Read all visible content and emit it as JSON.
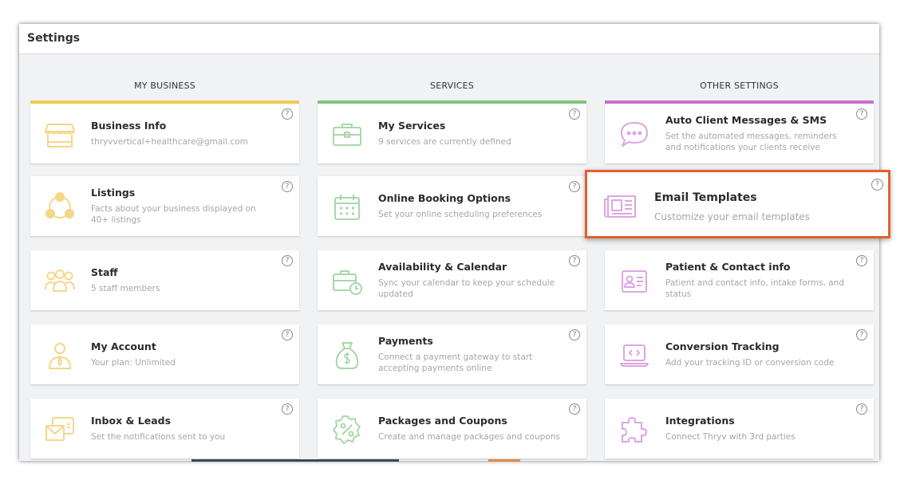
{
  "window": {
    "title": "Settings"
  },
  "columns": [
    {
      "header": "MY BUSINESS",
      "accent": "#f2c94c",
      "icon_color": "#f5d78a"
    },
    {
      "header": "SERVICES",
      "accent": "#7dc47d",
      "icon_color": "#a8d8a8"
    },
    {
      "header": "OTHER SETTINGS",
      "accent": "#c56fcf",
      "icon_color": "#dca6e2"
    }
  ],
  "help_glyph": "?",
  "cards": {
    "business_info": {
      "title": "Business Info",
      "desc": "thryvvertical+healthcare@gmail.com",
      "icon": "storefront-icon"
    },
    "listings": {
      "title": "Listings",
      "desc": "Facts about your business displayed on 40+ listings",
      "icon": "network-people-icon"
    },
    "staff": {
      "title": "Staff",
      "desc": "5 staff members",
      "icon": "group-icon"
    },
    "my_account": {
      "title": "My Account",
      "desc": "Your plan: Unlimited",
      "icon": "person-icon"
    },
    "inbox_leads": {
      "title": "Inbox & Leads",
      "desc": "Set the notifications sent to you",
      "icon": "envelope-icon"
    },
    "my_services": {
      "title": "My Services",
      "desc": "9 services are currently defined",
      "icon": "briefcase-icon"
    },
    "online_booking": {
      "title": "Online Booking Options",
      "desc": "Set your online scheduling preferences",
      "icon": "calendar-icon"
    },
    "availability": {
      "title": "Availability & Calendar",
      "desc": "Sync your calendar to keep your schedule updated",
      "icon": "briefcase-clock-icon"
    },
    "payments": {
      "title": "Payments",
      "desc": "Connect a payment gateway to start accepting payments online",
      "icon": "money-bag-icon"
    },
    "packages": {
      "title": "Packages and Coupons",
      "desc": "Create and manage packages and coupons",
      "icon": "discount-badge-icon"
    },
    "auto_messages": {
      "title": "Auto Client Messages & SMS",
      "desc": "Set the automated messages, reminders and notifications your clients receive",
      "icon": "chat-bubble-icon"
    },
    "email_templates": {
      "title": "Email Templates",
      "desc": "Customize your email templates",
      "icon": "newspaper-icon"
    },
    "patient_contact": {
      "title": "Patient & Contact info",
      "desc": "Patient and contact info, intake forms, and status",
      "icon": "id-card-icon"
    },
    "conversion_tracking": {
      "title": "Conversion Tracking",
      "desc": "Add your tracking ID or conversion code",
      "icon": "laptop-code-icon"
    },
    "integrations": {
      "title": "Integrations",
      "desc": "Connect Thryv with 3rd parties",
      "icon": "puzzle-icon"
    }
  },
  "highlight_color": "#e2622a"
}
